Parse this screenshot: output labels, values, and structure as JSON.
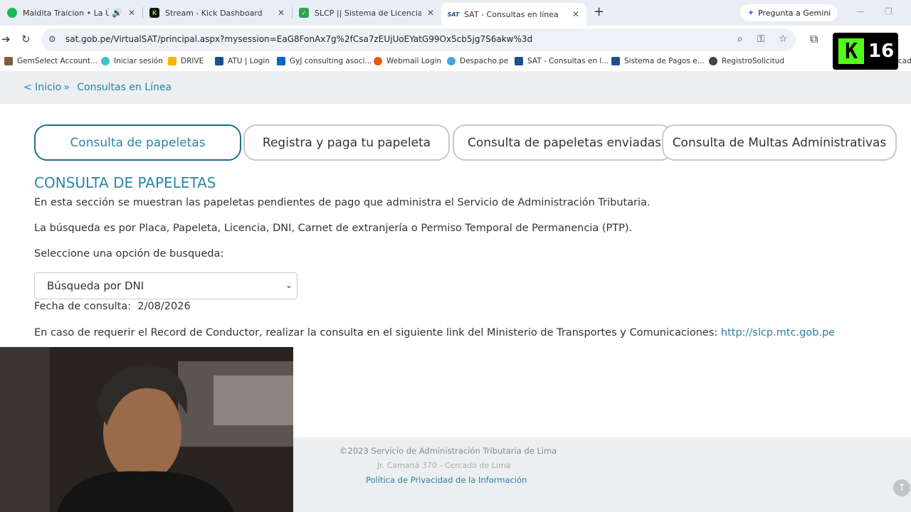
{
  "browser": {
    "tabs": [
      {
        "title": "Maldita Traicion • La Única",
        "favicon_color": "#1db954",
        "active": false
      },
      {
        "title": "Stream - Kick Dashboard",
        "favicon_color": "#53fc18",
        "active": false
      },
      {
        "title": "SLCP || Sistema de Licencias de",
        "favicon_color": "#2ea44f",
        "active": false
      },
      {
        "title": "SAT - Consultas en línea",
        "favicon_color": "#1f4e8c",
        "active": true
      }
    ],
    "gemini_label": "Pregunta a Gemini",
    "url": "sat.gob.pe/VirtualSAT/principal.aspx?mysession=EaG8FonAx7g%2fCsa7zEUjUoEYatG99Ox5cb5jg7S6akw%3d",
    "bookmarks": [
      {
        "label": "GemSelect Account...",
        "color": "#7a5c3e"
      },
      {
        "label": "Iniciar sesión",
        "color": "#3ec1c9"
      },
      {
        "label": "DRIVE",
        "color": "#f4b400"
      },
      {
        "label": "ATU | Login",
        "color": "#1f4e8c"
      },
      {
        "label": "GyJ consulting asoci...",
        "color": "#0a66c2"
      },
      {
        "label": "Webmail Login",
        "color": "#e8590c"
      },
      {
        "label": "Despacho.pe",
        "color": "#4aa3df"
      },
      {
        "label": "SAT - Consultas en l...",
        "color": "#1f4e8c"
      },
      {
        "label": "Sistema de Pagos e...",
        "color": "#1f4e8c"
      },
      {
        "label": "RegistroSolicitud",
        "color": "#444444"
      }
    ],
    "bookmark_overflow": "cado"
  },
  "overlay": {
    "kick_count": "16"
  },
  "breadcrumb": {
    "back": "< Inicio",
    "sep": "»",
    "current": "Consultas en Línea"
  },
  "tabs": [
    {
      "label": "Consulta de papeletas"
    },
    {
      "label": "Registra y paga tu papeleta"
    },
    {
      "label": "Consulta de papeletas enviadas a"
    },
    {
      "label": "Consulta de Multas Administrativas"
    }
  ],
  "content": {
    "heading": "CONSULTA DE PAPELETAS",
    "p1": "En esta sección se muestran las papeletas pendientes de pago que administra el Servicio de Administración Tributaria.",
    "p2": "La búsqueda es por Placa, Papeleta, Licencia, DNI, Carnet de extranjería o Permiso Temporal de Permanencia (PTP).",
    "select_label": "Seleccione una opción de busqueda:",
    "select_value": "Búsqueda por DNI",
    "date_label": "Fecha de consulta:",
    "date_value": "2/08/2026",
    "record_text": "En caso de requerir el Record de Conductor, realizar la consulta en el siguiente link del Ministerio de Transportes y Comunicaciones:",
    "record_link": "http://slcp.mtc.gob.pe"
  },
  "footer": {
    "copyright": "©2023 Servicio de Administración Tributaria de Lima",
    "address": "Jr. Camaná 370 - Cercado de Lima",
    "privacy": "Política de Privacidad de la Información"
  }
}
